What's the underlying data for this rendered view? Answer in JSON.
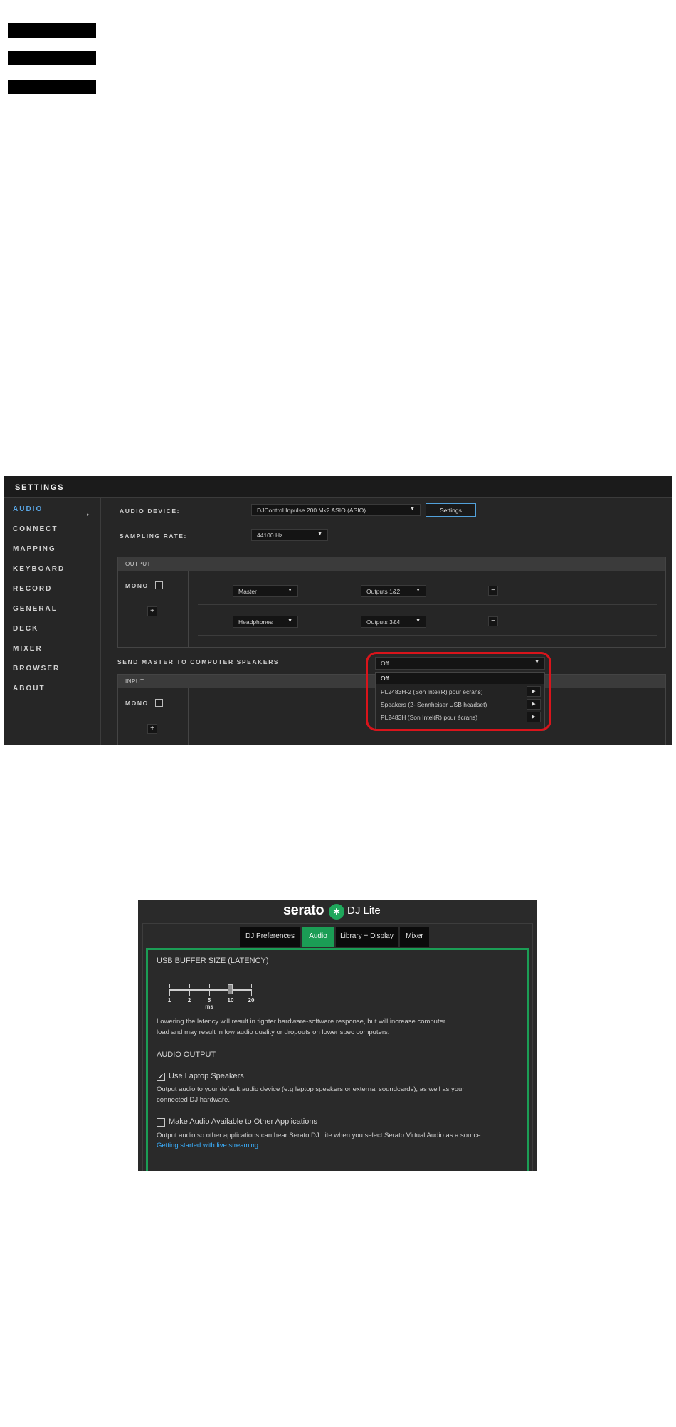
{
  "settings_panel": {
    "title": "SETTINGS",
    "nav": [
      {
        "label": "AUDIO",
        "active": true
      },
      {
        "label": "CONNECT"
      },
      {
        "label": "MAPPING"
      },
      {
        "label": "KEYBOARD"
      },
      {
        "label": "RECORD"
      },
      {
        "label": "GENERAL"
      },
      {
        "label": "DECK"
      },
      {
        "label": "MIXER"
      },
      {
        "label": "BROWSER"
      },
      {
        "label": "ABOUT"
      }
    ],
    "audio_device_label": "AUDIO DEVICE:",
    "audio_device_value": "DJControl Inpulse 200 Mk2 ASIO (ASIO)",
    "settings_button": "Settings",
    "sampling_rate_label": "SAMPLING RATE:",
    "sampling_rate_value": "44100 Hz",
    "output": {
      "header": "OUTPUT",
      "mono_label": "MONO",
      "add": "+",
      "rows": [
        {
          "channel": "Master",
          "outputs": "Outputs 1&2",
          "remove": "−"
        },
        {
          "channel": "Headphones",
          "outputs": "Outputs 3&4",
          "remove": "−"
        }
      ]
    },
    "send_master_label": "SEND MASTER TO COMPUTER SPEAKERS",
    "send_master_value": "Off",
    "send_master_options": [
      {
        "label": "Off",
        "selected": true
      },
      {
        "label": "PL2483H-2 (Son Intel(R) pour écrans)",
        "play": "▶"
      },
      {
        "label": "Speakers (2- Sennheiser USB headset)",
        "play": "▶"
      },
      {
        "label": "PL2483H (Son Intel(R) pour écrans)",
        "play": "▶"
      }
    ],
    "input": {
      "header": "INPUT",
      "mono_label": "MONO",
      "add": "+"
    },
    "highlight_color": "#d9141b",
    "accent_color": "#5aa7e6"
  },
  "serato": {
    "brand": "serato",
    "logo_icon": "serato-logo-icon",
    "product": "DJ Lite",
    "tabs": [
      {
        "label": "DJ Preferences"
      },
      {
        "label": "Audio",
        "active": true
      },
      {
        "label": "Library + Display"
      },
      {
        "label": "Mixer"
      }
    ],
    "usb_buffer_title": "USB BUFFER SIZE (LATENCY)",
    "latency_ticks": [
      "1",
      "2",
      "5",
      "10",
      "20"
    ],
    "latency_unit": "ms",
    "latency_selected": "10",
    "latency_note": "Lowering the latency will result in tighter hardware-software response, but will increase computer load and may result in low audio quality or dropouts on lower spec computers.",
    "audio_output_title": "AUDIO OUTPUT",
    "use_laptop_label": "Use Laptop Speakers",
    "use_laptop_checked": true,
    "use_laptop_note": "Output audio to your default audio device (e.g laptop speakers or external soundcards), as well as your connected DJ hardware.",
    "virtual_audio_label": "Make Audio Available to Other Applications",
    "virtual_audio_checked": false,
    "virtual_audio_note": "Output audio so other applications can hear Serato DJ Lite when you select Serato Virtual Audio as a source.",
    "streaming_link": "Getting started with live streaming",
    "accent_color": "#1b9d55"
  }
}
